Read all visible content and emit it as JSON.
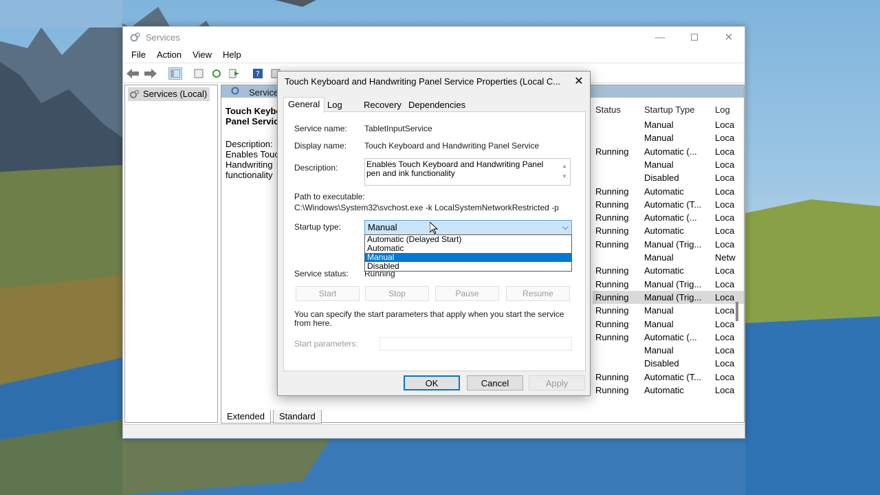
{
  "window": {
    "title": "Services",
    "menu": [
      "File",
      "Action",
      "View",
      "Help"
    ],
    "tree_root": "Services (Local)",
    "pane_title": "Services",
    "description_panel": {
      "service_name_line1": "Touch Keybo",
      "service_name_line2": "Panel Servic",
      "label": "Description:",
      "text_lines": [
        "Enables Touc",
        "Handwriting",
        "functionality"
      ]
    },
    "columns": [
      "Status",
      "Startup Type",
      "Log"
    ],
    "rows": [
      {
        "status": "",
        "startup": "Manual",
        "log": "Loca"
      },
      {
        "status": "",
        "startup": "Manual",
        "log": "Loca"
      },
      {
        "status": "Running",
        "startup": "Automatic (...",
        "log": "Loca"
      },
      {
        "status": "",
        "startup": "Manual",
        "log": "Loca"
      },
      {
        "status": "",
        "startup": "Disabled",
        "log": "Loca"
      },
      {
        "status": "Running",
        "startup": "Automatic",
        "log": "Loca"
      },
      {
        "status": "Running",
        "startup": "Automatic (T...",
        "log": "Loca"
      },
      {
        "status": "Running",
        "startup": "Automatic (...",
        "log": "Loca"
      },
      {
        "status": "Running",
        "startup": "Automatic",
        "log": "Loca"
      },
      {
        "status": "Running",
        "startup": "Manual (Trig...",
        "log": "Loca"
      },
      {
        "status": "",
        "startup": "Manual",
        "log": "Netw"
      },
      {
        "status": "Running",
        "startup": "Automatic",
        "log": "Loca"
      },
      {
        "status": "Running",
        "startup": "Manual (Trig...",
        "log": "Loca"
      },
      {
        "status": "Running",
        "startup": "Manual (Trig...",
        "log": "Loca"
      },
      {
        "status": "Running",
        "startup": "Manual",
        "log": "Loca"
      },
      {
        "status": "Running",
        "startup": "Manual",
        "log": "Loca"
      },
      {
        "status": "Running",
        "startup": "Automatic (...",
        "log": "Loca"
      },
      {
        "status": "",
        "startup": "Manual",
        "log": "Loca"
      },
      {
        "status": "",
        "startup": "Disabled",
        "log": "Loca"
      },
      {
        "status": "Running",
        "startup": "Automatic (T...",
        "log": "Loca"
      },
      {
        "status": "Running",
        "startup": "Automatic",
        "log": "Loca"
      }
    ],
    "bottom_tabs": [
      "Extended",
      "Standard"
    ]
  },
  "dialog": {
    "title": "Touch Keyboard and Handwriting Panel Service Properties (Local C...",
    "tabs": [
      "General",
      "Log On",
      "Recovery",
      "Dependencies"
    ],
    "service_name_label": "Service name:",
    "service_name": "TabletInputService",
    "display_name_label": "Display name:",
    "display_name": "Touch Keyboard and Handwriting Panel Service",
    "description_label": "Description:",
    "description_line1": "Enables Touch Keyboard and Handwriting Panel",
    "description_line2": "pen and ink functionality",
    "path_label": "Path to executable:",
    "path": "C:\\Windows\\System32\\svchost.exe -k LocalSystemNetworkRestricted -p",
    "startup_label": "Startup type:",
    "startup_value": "Manual",
    "startup_options": [
      "Automatic (Delayed Start)",
      "Automatic",
      "Manual",
      "Disabled"
    ],
    "status_label": "Service status:",
    "status_value": "Running",
    "buttons": {
      "start": "Start",
      "stop": "Stop",
      "pause": "Pause",
      "resume": "Resume"
    },
    "help_line1": "You can specify the start parameters that apply when you start the service",
    "help_line2": "from here.",
    "params_label": "Start parameters:",
    "ok": "OK",
    "cancel": "Cancel",
    "apply": "Apply"
  },
  "colors": {
    "accent": "#0078d7",
    "header_band": "#a7bfd6",
    "selection": "#d9d9d9"
  }
}
